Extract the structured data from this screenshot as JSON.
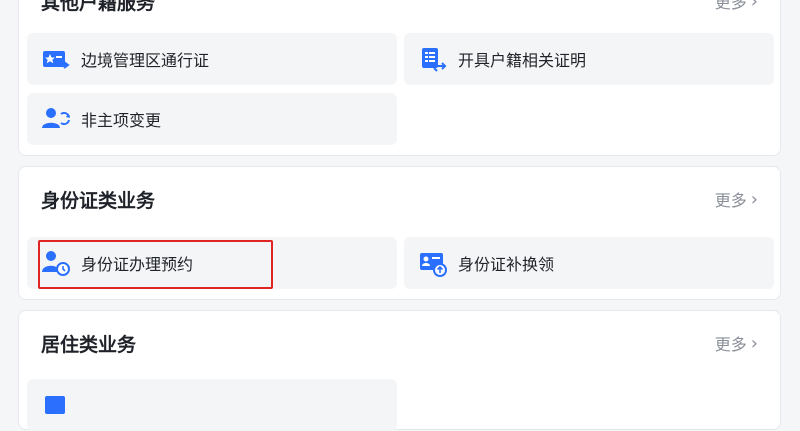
{
  "section_household": {
    "title": "其他户籍服务",
    "more_label": "更多",
    "items": [
      {
        "label": "边境管理区通行证",
        "icon": "border-pass-icon"
      },
      {
        "label": "开具户籍相关证明",
        "icon": "household-document-icon"
      },
      {
        "label": "非主项变更",
        "icon": "person-change-icon"
      }
    ]
  },
  "section_id": {
    "title": "身份证类业务",
    "more_label": "更多",
    "items": [
      {
        "label": "身份证办理预约",
        "icon": "person-clock-icon",
        "highlighted": true
      },
      {
        "label": "身份证补换领",
        "icon": "id-card-renew-icon"
      }
    ]
  },
  "section_residence": {
    "title": "居住类业务",
    "more_label": "更多",
    "items": [
      {
        "label": "",
        "icon": "residence-icon"
      }
    ]
  },
  "colors": {
    "accent": "#2b6fff",
    "highlight_border": "#e02424",
    "tile_bg": "#f4f5f7",
    "card_bg": "#ffffff",
    "page_bg": "#f5f6f8"
  }
}
